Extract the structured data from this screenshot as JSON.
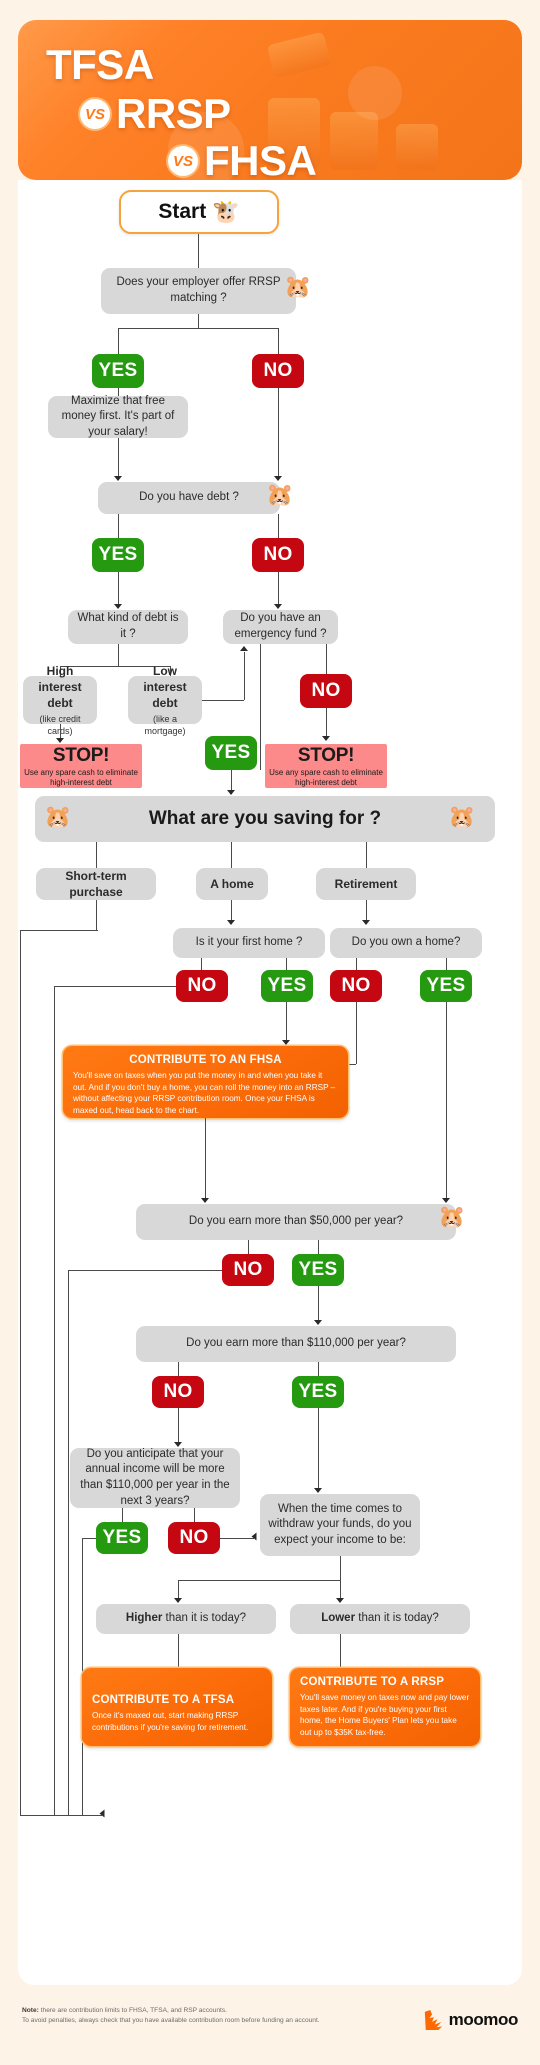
{
  "header": {
    "line1": "TFSA",
    "line2_vs": "VS",
    "line2": "RRSP",
    "line3_vs": "VS",
    "line3": "FHSA"
  },
  "flow": {
    "start": "Start",
    "start_emoji": "🐮",
    "q_employer": "Does your employer offer RRSP matching ?",
    "yes": "YES",
    "no": "NO",
    "maximize": "Maximize that free money first. It's part of your salary!",
    "q_debt": "Do you have debt ?",
    "q_debt_kind": "What kind of debt is it ?",
    "q_emergency": "Do you have an emergency fund ?",
    "high_interest_title": "High interest debt",
    "high_interest_sub": "(like credit cards)",
    "low_interest_title": "Low interest debt",
    "low_interest_sub": "(like a mortgage)",
    "stop_title": "STOP!",
    "stop_desc": "Use any spare cash to eliminate high-interest debt",
    "q_saving_for": "What are you saving for ?",
    "opt_short_term": "Short-term purchase",
    "opt_home": "A home",
    "opt_retirement": "Retirement",
    "q_first_home": "Is it your first home ?",
    "q_own_home": "Do you own a home?",
    "cta_fhsa_title": "CONTRIBUTE TO AN FHSA",
    "cta_fhsa_body": "You'll save on taxes when you put the money in and when you take it out. And if you don't buy a home, you can roll the money into an RRSP – without affecting your RRSP contribution room. Once your FHSA is maxed out, head back to the chart.",
    "q_earn_50k": "Do you earn more than $50,000 per year?",
    "q_earn_110k": "Do you earn more than $110,000 per year?",
    "q_anticipate": "Do you anticipate that your annual income will be more than $110,000 per year in the next 3 years?",
    "q_withdraw": "When the time comes to withdraw your funds, do you expect your income to be:",
    "opt_higher_strong": "Higher",
    "opt_higher_rest": " than it is today?",
    "opt_lower_strong": "Lower",
    "opt_lower_rest": " than it is today?",
    "cta_tfsa_title": "CONTRIBUTE TO A TFSA",
    "cta_tfsa_body": "Once it's maxed out, start making RRSP contributions if you're saving for retirement.",
    "cta_rrsp_title": "CONTRIBUTE TO A RRSP",
    "cta_rrsp_body": "You'll save money on taxes now and pay lower taxes later. And if you're buying your first home, the Home Buyers' Plan lets you take out up to $35K tax-free."
  },
  "footer": {
    "note_label": "Note:",
    "note_line1": " there are contribution limits to FHSA, TFSA, and RSP accounts.",
    "note_line2": "To avoid penalties, always check that you have available contribution room before funding an account.",
    "brand": "moomoo"
  },
  "colors": {
    "accent": "#ff7a1a",
    "yes": "#259a11",
    "no": "#c50712",
    "stop": "#fc8a8a",
    "question": "#d8d8d8",
    "page_bg": "#fdf3e6"
  }
}
